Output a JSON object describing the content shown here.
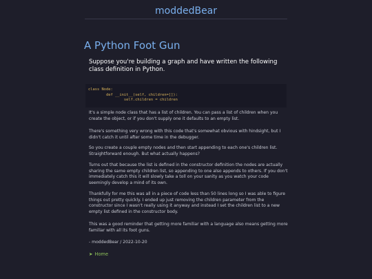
{
  "site": {
    "title": "moddedBear"
  },
  "post": {
    "title": "A Python Foot Gun",
    "lead": "Suppose you're building a graph and have written the following class definition in Python.",
    "code": "class Node:\n        def __init__(self, children=[]):\n                self.children = children",
    "paragraphs": [
      "It's a simple node class that has a list of children. You can pass a list of children when you create the object, or if you don't supply one it defaults to an empty list.",
      "There's something very wrong with this code that's somewhat obvious with hindsight, but I didn't catch it until after some time in the debugger.",
      "So you create a couple empty nodes and then start appending to each one's children list. Straightforward enough. But what actually happens?",
      "Turns out that because the list is defined in the constructor definition the nodes are actually sharing the same empty children list, so appending to one also appends to others. If you don't immediately catch this it will slowly take a toll on your sanity as you watch your code seemingly develop a mind of its own.",
      "Thankfully for me this was all in a piece of code less than 50 lines long so I was able to figure things out pretty quickly. I ended up just removing the children parameter from the constructor since I wasn't really using it anyway and instead I set the children list to a new empty list defined in the constructor body.",
      "This was a good reminder that getting more familiar with a language also means getting more familiar with all its foot guns."
    ],
    "byline": "- moddedBear / 2022-10-20"
  },
  "nav": {
    "arrow": "➤",
    "home_label": "Home"
  }
}
